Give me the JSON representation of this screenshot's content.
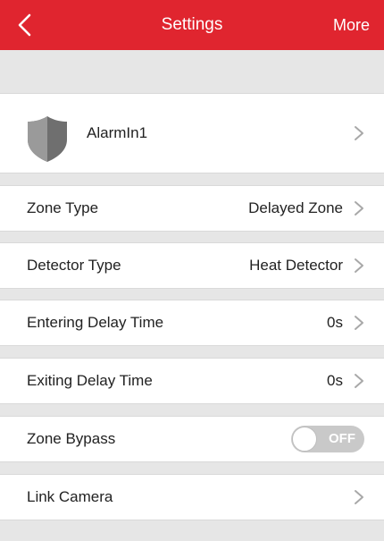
{
  "header": {
    "title": "Settings",
    "more_label": "More",
    "accent_color": "#e0252f",
    "back_icon": "chevron-left-icon"
  },
  "device": {
    "name": "AlarmIn1",
    "icon": "shield-icon"
  },
  "rows": {
    "zone_type": {
      "label": "Zone Type",
      "value": "Delayed Zone"
    },
    "detector_type": {
      "label": "Detector Type",
      "value": "Heat Detector"
    },
    "entering_delay": {
      "label": "Entering Delay Time",
      "value": "0s"
    },
    "exiting_delay": {
      "label": "Exiting Delay Time",
      "value": "0s"
    },
    "zone_bypass": {
      "label": "Zone Bypass",
      "toggle_text": "OFF",
      "enabled": false
    },
    "link_camera": {
      "label": "Link Camera"
    }
  }
}
